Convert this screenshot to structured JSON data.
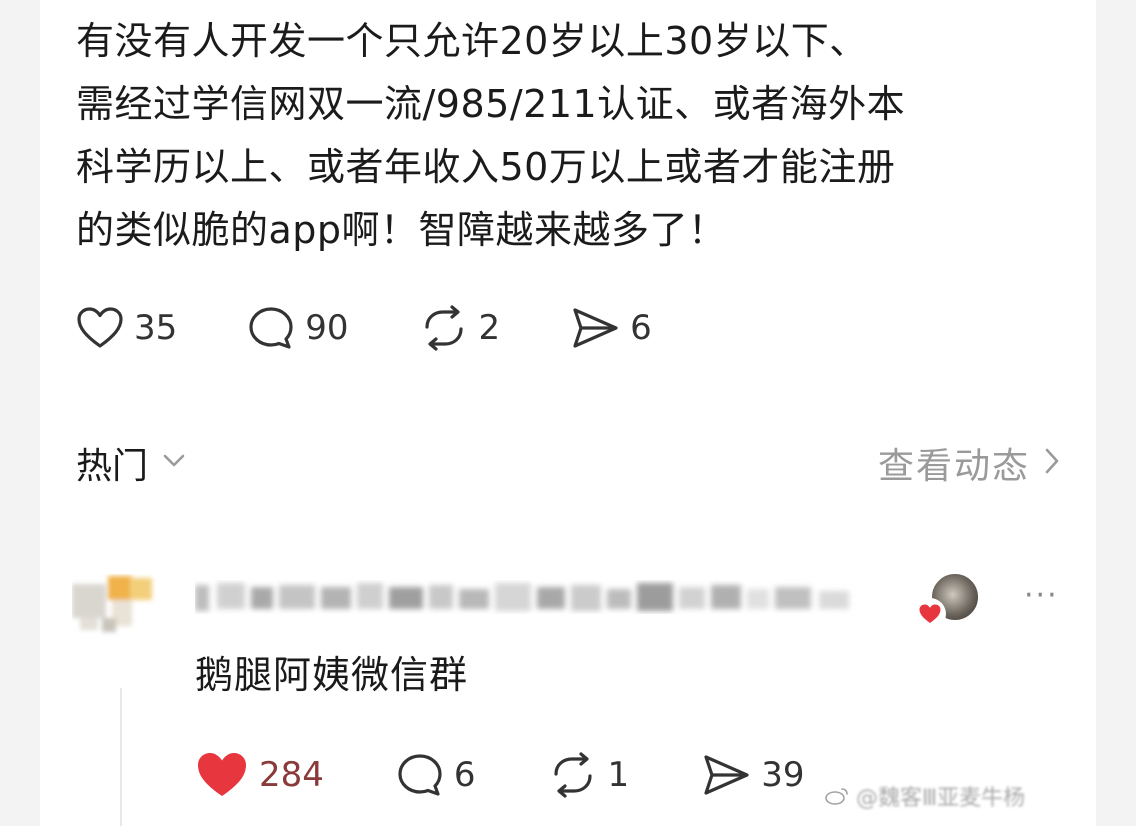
{
  "post": {
    "text_lines": [
      "有没有人开发一个只允许20岁以上30岁以下、",
      "需经过学信网双一流/985/211认证、或者海外本",
      "科学历以上、或者年收入50万以上或者才能注册",
      "的类似脆的app啊！智障越来越多了！"
    ],
    "actions": {
      "like_count": "35",
      "comment_count": "90",
      "repost_count": "2",
      "share_count": "6"
    }
  },
  "comments_header": {
    "sort_label": "热门",
    "view_activity_label": "查看动态"
  },
  "comment": {
    "more_label": "···",
    "text": "鹅腿阿姨微信群",
    "actions": {
      "like_count": "284",
      "reply_count": "6",
      "repost_count": "1",
      "share_count": "39"
    }
  },
  "watermark": {
    "text": "@魏客Ⅲ亚麦牛杨"
  },
  "colors": {
    "liked_heart": "#e8363f",
    "secondary_text": "#9a9a9a",
    "icon_stroke": "#333333"
  },
  "icons": [
    "heart-icon",
    "comment-icon",
    "repost-icon",
    "share-icon",
    "chevron-down-icon",
    "chevron-right-icon",
    "more-icon",
    "weibo-logo-icon"
  ]
}
